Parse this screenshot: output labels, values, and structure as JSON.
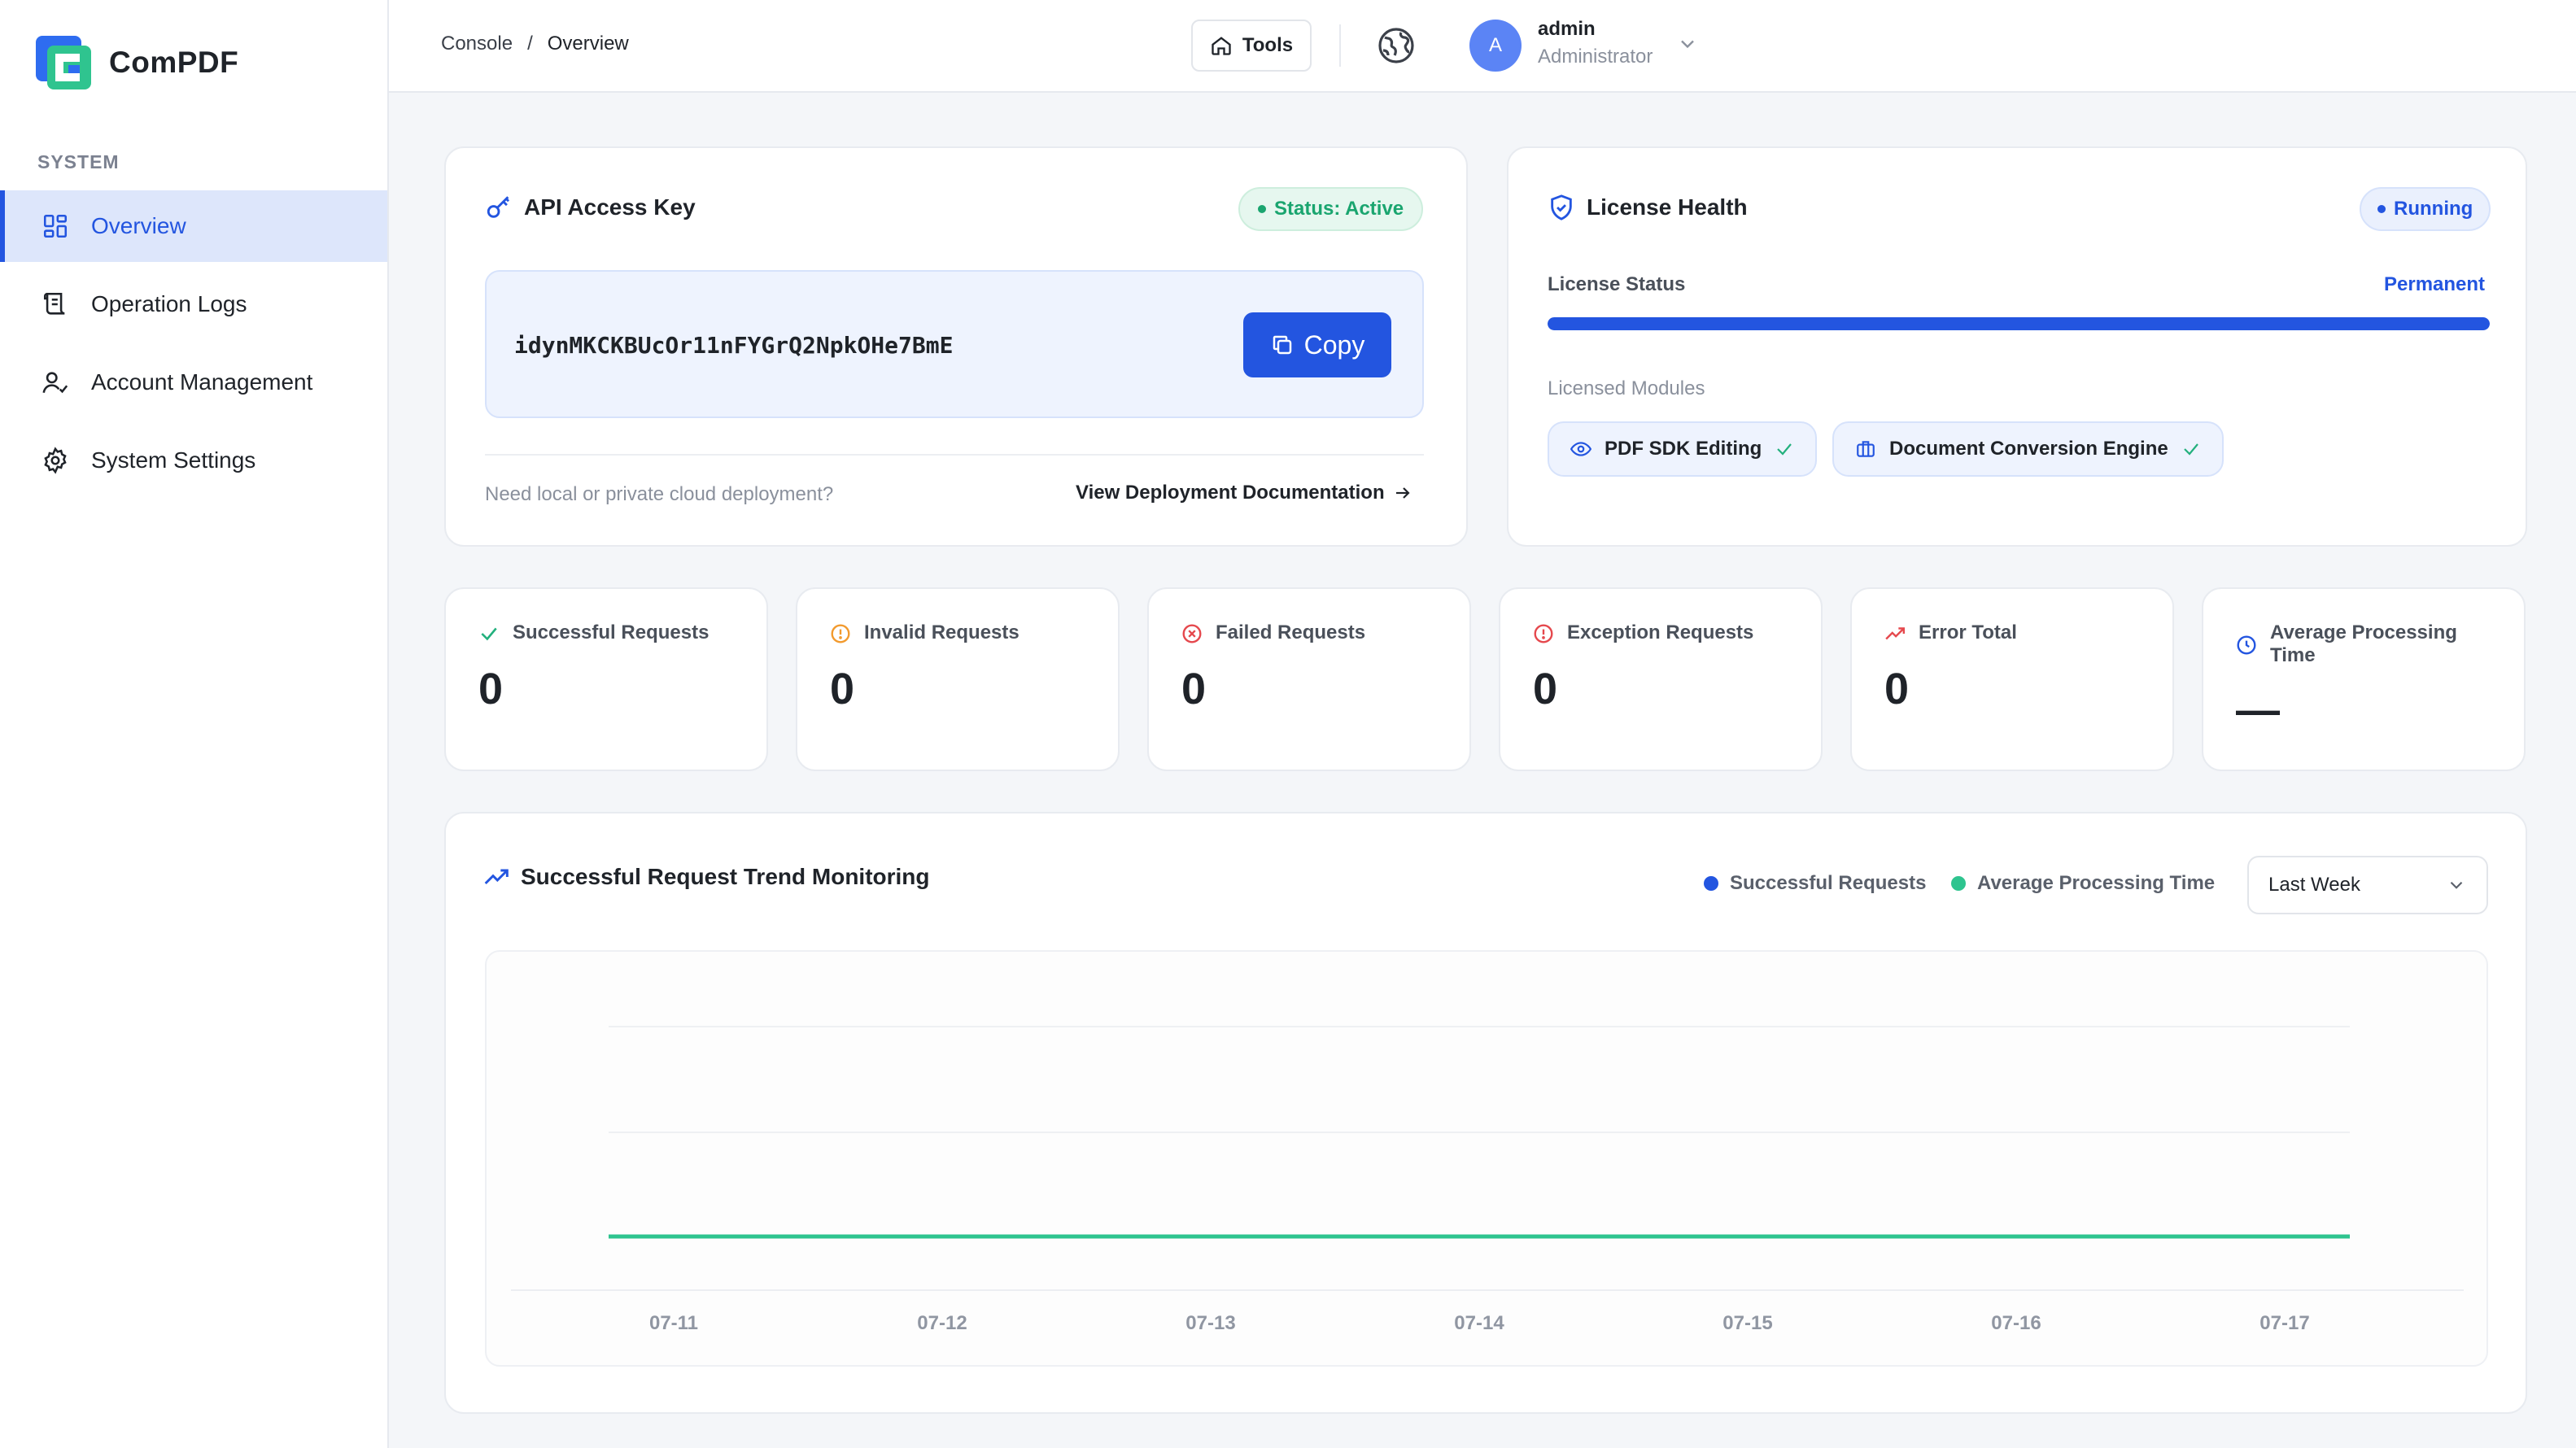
{
  "brand": {
    "name": "ComPDF"
  },
  "sidebar": {
    "section_label": "SYSTEM",
    "items": [
      {
        "label": "Overview",
        "icon": "dashboard-grid-icon",
        "active": true
      },
      {
        "label": "Operation Logs",
        "icon": "scroll-log-icon",
        "active": false
      },
      {
        "label": "Account Management",
        "icon": "user-check-icon",
        "active": false
      },
      {
        "label": "System Settings",
        "icon": "gear-icon",
        "active": false
      }
    ]
  },
  "header": {
    "breadcrumb": [
      "Console",
      "Overview"
    ],
    "breadcrumb_sep": "/",
    "tools_label": "Tools",
    "user": {
      "avatar_initial": "A",
      "name": "admin",
      "role": "Administrator"
    }
  },
  "api_card": {
    "title": "API Access Key",
    "status": "Status: Active",
    "key": "idynMKCKBUcOr11nFYGrQ2NpkOHe7BmE",
    "copy_label": "Copy",
    "footer_text": "Need local or private cloud deployment?",
    "docs_link": "View Deployment Documentation"
  },
  "license_card": {
    "title": "License Health",
    "badge": "Running",
    "status_label": "License Status",
    "status_value": "Permanent",
    "progress": 1.0,
    "modules_label": "Licensed Modules",
    "modules": [
      "PDF SDK Editing",
      "Document Conversion Engine"
    ]
  },
  "stats": [
    {
      "label": "Successful Requests",
      "value": "0",
      "icon": "check-icon",
      "color": "#22b07d"
    },
    {
      "label": "Invalid Requests",
      "value": "0",
      "icon": "alert-circle-icon",
      "color": "#f29a2e"
    },
    {
      "label": "Failed Requests",
      "value": "0",
      "icon": "x-circle-icon",
      "color": "#e5484d"
    },
    {
      "label": "Exception Requests",
      "value": "0",
      "icon": "exclamation-circle-icon",
      "color": "#e5484d"
    },
    {
      "label": "Error Total",
      "value": "0",
      "icon": "trending-up-icon",
      "color": "#e5484d"
    },
    {
      "label": "Average Processing Time",
      "value": "—",
      "icon": "clock-icon",
      "color": "#2355e0"
    }
  ],
  "trend": {
    "title": "Successful Request Trend Monitoring",
    "legend": [
      {
        "label": "Successful Requests",
        "color": "#2355e0"
      },
      {
        "label": "Average Processing Time",
        "color": "#2ec48f"
      }
    ],
    "range": "Last Week"
  },
  "chart_data": {
    "type": "line",
    "x": [
      "07-11",
      "07-12",
      "07-13",
      "07-14",
      "07-15",
      "07-16",
      "07-17"
    ],
    "series": [
      {
        "name": "Successful Requests",
        "values": [
          0,
          0,
          0,
          0,
          0,
          0,
          0
        ],
        "color": "#2355e0"
      },
      {
        "name": "Average Processing Time",
        "values": [
          0,
          0,
          0,
          0,
          0,
          0,
          0
        ],
        "color": "#2ec48f"
      }
    ],
    "grid": true
  },
  "colors": {
    "accent": "#2355e0",
    "success": "#22b07d",
    "danger": "#e5484d",
    "warning": "#f29a2e"
  }
}
